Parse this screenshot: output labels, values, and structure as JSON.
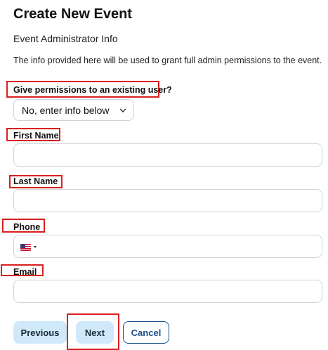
{
  "header": {
    "title": "Create New Event",
    "subtitle": "Event Administrator Info",
    "description": "The info provided here will be used to grant full admin permissions to the event."
  },
  "form": {
    "permissions": {
      "label": "Give permissions to an existing user?",
      "value": "No, enter info below"
    },
    "first_name": {
      "label": "First Name",
      "value": "",
      "placeholder": ""
    },
    "last_name": {
      "label": "Last Name",
      "value": "",
      "placeholder": ""
    },
    "phone": {
      "label": "Phone",
      "value": "",
      "placeholder": "",
      "country_icon": "us-flag-icon"
    },
    "email": {
      "label": "Email",
      "value": "",
      "placeholder": ""
    }
  },
  "buttons": {
    "previous": "Previous",
    "next": "Next",
    "cancel": "Cancel"
  },
  "colors": {
    "highlight": "#d9201f",
    "button_light": "#cfe9fb",
    "outline": "#1b4f8a"
  }
}
